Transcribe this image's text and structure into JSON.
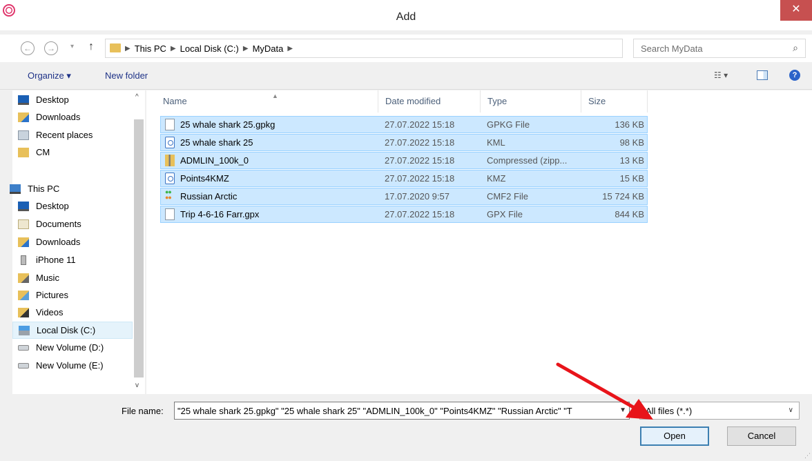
{
  "window": {
    "title": "Add",
    "close_glyph": "✕"
  },
  "address": {
    "crumbs": [
      "This PC",
      "Local Disk (C:)",
      "MyData"
    ],
    "search_placeholder": "Search MyData"
  },
  "toolbar": {
    "organize": "Organize ▾",
    "new_folder": "New folder"
  },
  "nav": {
    "favorites": [
      {
        "label": "Desktop",
        "icon": "desktop-icon"
      },
      {
        "label": "Downloads",
        "icon": "downloads-icon"
      },
      {
        "label": "Recent places",
        "icon": "recent-places-icon"
      },
      {
        "label": "CM",
        "icon": "folder-icon"
      }
    ],
    "this_pc": "This PC",
    "pc_items": [
      {
        "label": "Desktop",
        "icon": "desktop-icon"
      },
      {
        "label": "Documents",
        "icon": "documents-icon"
      },
      {
        "label": "Downloads",
        "icon": "downloads-icon"
      },
      {
        "label": "iPhone 11",
        "icon": "phone-icon"
      },
      {
        "label": "Music",
        "icon": "music-icon"
      },
      {
        "label": "Pictures",
        "icon": "pictures-icon"
      },
      {
        "label": "Videos",
        "icon": "videos-icon"
      },
      {
        "label": "Local Disk (C:)",
        "icon": "local-disk-icon",
        "selected": true
      },
      {
        "label": "New Volume (D:)",
        "icon": "drive-icon"
      },
      {
        "label": "New Volume (E:)",
        "icon": "drive-icon"
      }
    ]
  },
  "columns": {
    "name": "Name",
    "date": "Date modified",
    "type": "Type",
    "size": "Size"
  },
  "files": [
    {
      "name": "25 whale shark 25.gpkg",
      "date": "27.07.2022 15:18",
      "type": "GPKG File",
      "size": "136 KB",
      "icon": "file-icon"
    },
    {
      "name": "25 whale shark 25",
      "date": "27.07.2022 15:18",
      "type": "KML",
      "size": "98 KB",
      "icon": "kml-icon"
    },
    {
      "name": "ADMLIN_100k_0",
      "date": "27.07.2022 15:18",
      "type": "Compressed (zipp...",
      "size": "13 KB",
      "icon": "zip-icon"
    },
    {
      "name": "Points4KMZ",
      "date": "27.07.2022 15:18",
      "type": "KMZ",
      "size": "15 KB",
      "icon": "kmz-icon"
    },
    {
      "name": "Russian Arctic",
      "date": "17.07.2020 9:57",
      "type": "CMF2 File",
      "size": "15 724 KB",
      "icon": "cmf2-icon"
    },
    {
      "name": "Trip 4-6-16 Farr.gpx",
      "date": "27.07.2022 15:18",
      "type": "GPX File",
      "size": "844 KB",
      "icon": "file-icon"
    }
  ],
  "bottom": {
    "file_name_label": "File name:",
    "file_name_value": "\"25 whale shark 25.gpkg\" \"25 whale shark 25\" \"ADMLIN_100k_0\" \"Points4KMZ\" \"Russian Arctic\" \"T",
    "filter": "All files (*.*)",
    "open": "Open",
    "cancel": "Cancel"
  },
  "colors": {
    "selection": "#cce8ff",
    "selection_border": "#99d1ff",
    "close": "#c75050",
    "annotation_arrow": "#e8141a"
  }
}
